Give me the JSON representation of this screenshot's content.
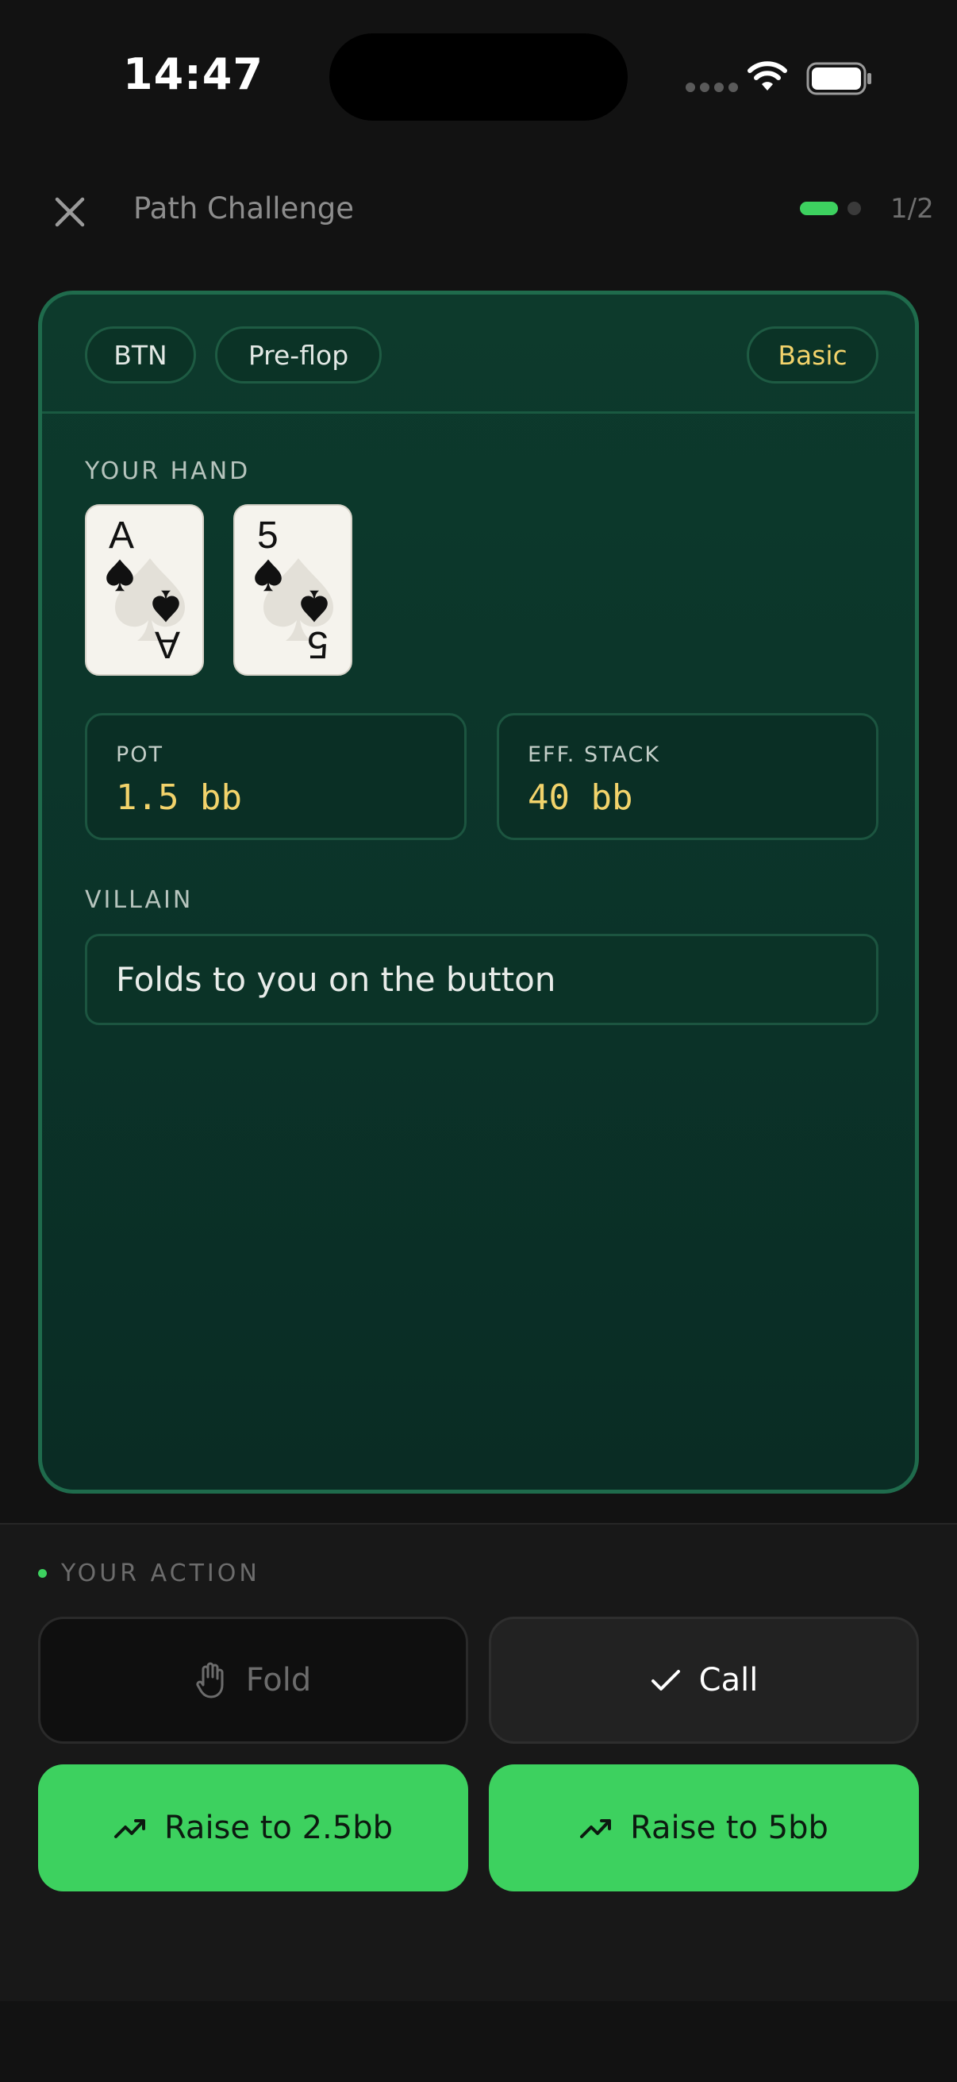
{
  "status_bar": {
    "time": "14:47"
  },
  "header": {
    "title": "Path Challenge",
    "progress_text": "1/2",
    "progress_current": 1,
    "progress_total": 2
  },
  "scenario": {
    "chips": {
      "position": "BTN",
      "street": "Pre-flop",
      "difficulty": "Basic"
    },
    "hand_label": "YOUR HAND",
    "cards": [
      {
        "rank": "A",
        "suit": "spades"
      },
      {
        "rank": "5",
        "suit": "spades"
      }
    ],
    "pot": {
      "label": "POT",
      "value": "1.5 bb"
    },
    "stack": {
      "label": "EFF. STACK",
      "value": "40 bb"
    },
    "villain_label": "VILLAIN",
    "villain_text": "Folds to you on the button"
  },
  "actions": {
    "label": "YOUR ACTION",
    "fold": "Fold",
    "call": "Call",
    "raise_small": "Raise to 2.5bb",
    "raise_big": "Raise to 5bb"
  },
  "colors": {
    "accent_green": "#3dd15f",
    "card_border": "#1f6b4c",
    "value_gold": "#f2d36b"
  }
}
